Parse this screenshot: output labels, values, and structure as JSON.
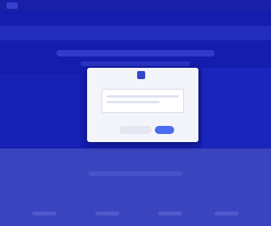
{
  "page": {
    "background_color": "#2f3bd0",
    "accent_color": "#4a6cf0"
  },
  "dialog": {
    "brand_icon": "app-logo-icon",
    "brand_name": "",
    "message": "",
    "cancel_label": "",
    "confirm_label": ""
  }
}
